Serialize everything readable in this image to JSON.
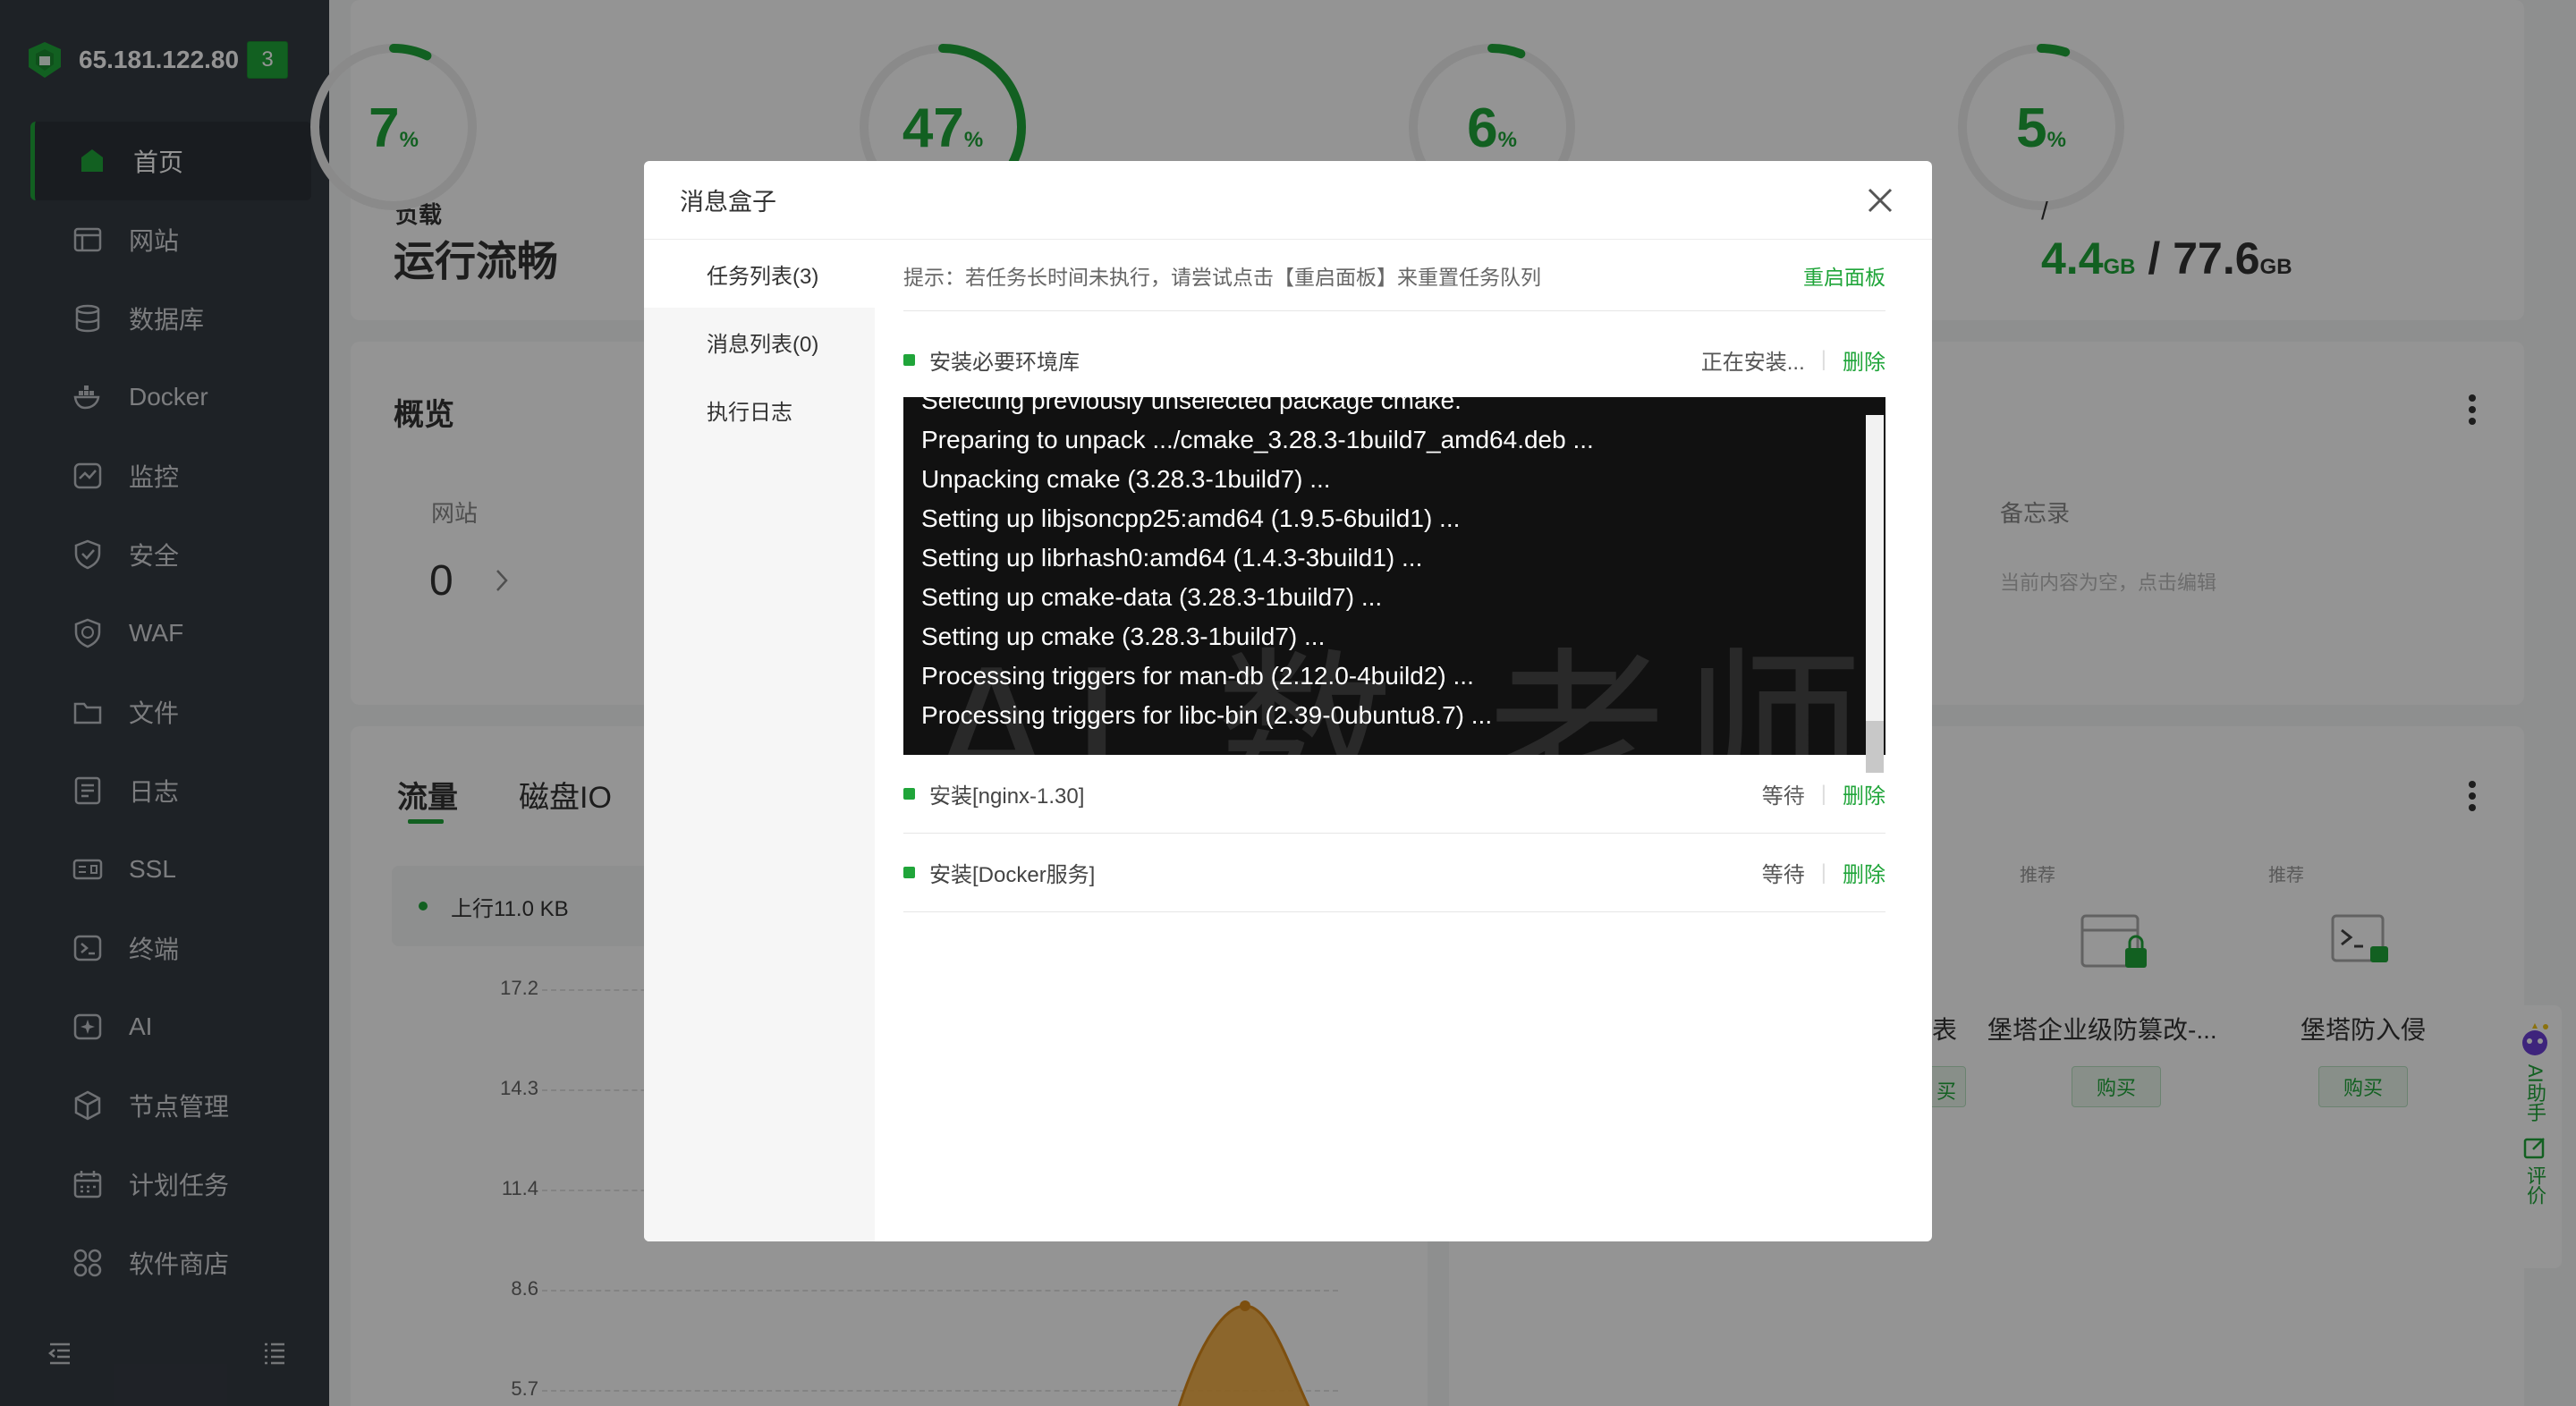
{
  "sidebar": {
    "ip": "65.181.122.80",
    "badge": "3",
    "items": [
      {
        "label": "首页",
        "icon": "home-icon"
      },
      {
        "label": "网站",
        "icon": "website-icon"
      },
      {
        "label": "数据库",
        "icon": "database-icon"
      },
      {
        "label": "Docker",
        "icon": "docker-icon"
      },
      {
        "label": "监控",
        "icon": "monitor-icon"
      },
      {
        "label": "安全",
        "icon": "shield-icon"
      },
      {
        "label": "WAF",
        "icon": "waf-icon"
      },
      {
        "label": "文件",
        "icon": "folder-icon"
      },
      {
        "label": "日志",
        "icon": "log-icon"
      },
      {
        "label": "SSL",
        "icon": "ssl-icon"
      },
      {
        "label": "终端",
        "icon": "terminal-icon"
      },
      {
        "label": "AI",
        "icon": "ai-icon"
      },
      {
        "label": "节点管理",
        "icon": "node-icon"
      },
      {
        "label": "计划任务",
        "icon": "calendar-icon"
      },
      {
        "label": "软件商店",
        "icon": "store-icon"
      }
    ]
  },
  "status": {
    "load_label": "负载",
    "load_value": "运行流畅",
    "gauges": [
      {
        "value": "7",
        "unit": "%",
        "percent": 7
      },
      {
        "value": "47",
        "unit": "%",
        "percent": 47
      },
      {
        "value": "6",
        "unit": "%",
        "percent": 6
      },
      {
        "value": "5",
        "unit": "%",
        "percent": 5
      }
    ],
    "disk_slash": "/",
    "disk_used": "4.4",
    "disk_used_unit": "GB",
    "disk_sep": " / ",
    "disk_total": "77.6",
    "disk_total_unit": "GB"
  },
  "overview": {
    "title": "概览",
    "site_label": "网站",
    "site_count": "0",
    "memo_label": "备忘录",
    "memo_placeholder": "当前内容为空，点击编辑"
  },
  "traffic": {
    "tab_traffic": "流量",
    "tab_disk": "磁盘IO",
    "legend_up": "上行11.0 KB",
    "y_ticks": [
      "17.2",
      "14.3",
      "11.4",
      "8.6",
      "5.7"
    ]
  },
  "recommend": {
    "tag1": "推荐",
    "tag2": "推荐",
    "partial": "表",
    "partial_buy": "买",
    "item1": "堡塔企业级防篡改-...",
    "item2": "堡塔防入侵",
    "buy": "购买"
  },
  "float_bar": {
    "ai_label": "AI助手",
    "review_label": "评价"
  },
  "dialog": {
    "title": "消息盒子",
    "tabs": [
      "任务列表(3)",
      "消息列表(0)",
      "执行日志"
    ],
    "tip": "提示：若任务长时间未执行，请尝试点击【重启面板】来重置任务队列",
    "restart": "重启面板",
    "tasks": [
      {
        "name": "安装必要环境库",
        "status": "正在安装...",
        "delete": "删除"
      },
      {
        "name": "安装[nginx-1.30]",
        "status": "等待",
        "delete": "删除"
      },
      {
        "name": "安装[Docker服务]",
        "status": "等待",
        "delete": "删除"
      }
    ],
    "console": [
      "Selecting previously unselected package cmake.",
      "Preparing to unpack .../cmake_3.28.3-1build7_amd64.deb ...",
      "Unpacking cmake (3.28.3-1build7) ...",
      "Setting up libjsoncpp25:amd64 (1.9.5-6build1) ...",
      "Setting up librhash0:amd64 (1.4.3-3build1) ...",
      "Setting up cmake-data (3.28.3-1build7) ...",
      "Setting up cmake (3.28.3-1build7) ...",
      "Processing triggers for man-db (2.12.0-4build2) ...",
      "Processing triggers for libc-bin (2.39-0ubuntu8.7) ..."
    ],
    "watermark": "AI 数 老师"
  },
  "colors": {
    "accent": "#20a53a",
    "sidebar": "#353b43",
    "chart_orange": "#f0a22e"
  }
}
